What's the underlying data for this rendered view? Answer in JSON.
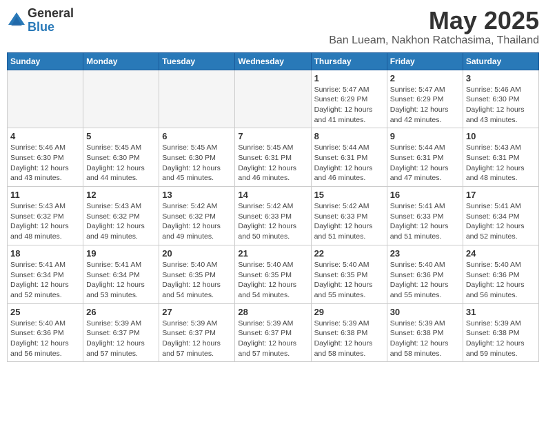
{
  "logo": {
    "general": "General",
    "blue": "Blue"
  },
  "title": "May 2025",
  "location": "Ban Lueam, Nakhon Ratchasima, Thailand",
  "days_of_week": [
    "Sunday",
    "Monday",
    "Tuesday",
    "Wednesday",
    "Thursday",
    "Friday",
    "Saturday"
  ],
  "weeks": [
    [
      {
        "day": "",
        "info": ""
      },
      {
        "day": "",
        "info": ""
      },
      {
        "day": "",
        "info": ""
      },
      {
        "day": "",
        "info": ""
      },
      {
        "day": "1",
        "info": "Sunrise: 5:47 AM\nSunset: 6:29 PM\nDaylight: 12 hours\nand 41 minutes."
      },
      {
        "day": "2",
        "info": "Sunrise: 5:47 AM\nSunset: 6:29 PM\nDaylight: 12 hours\nand 42 minutes."
      },
      {
        "day": "3",
        "info": "Sunrise: 5:46 AM\nSunset: 6:30 PM\nDaylight: 12 hours\nand 43 minutes."
      }
    ],
    [
      {
        "day": "4",
        "info": "Sunrise: 5:46 AM\nSunset: 6:30 PM\nDaylight: 12 hours\nand 43 minutes."
      },
      {
        "day": "5",
        "info": "Sunrise: 5:45 AM\nSunset: 6:30 PM\nDaylight: 12 hours\nand 44 minutes."
      },
      {
        "day": "6",
        "info": "Sunrise: 5:45 AM\nSunset: 6:30 PM\nDaylight: 12 hours\nand 45 minutes."
      },
      {
        "day": "7",
        "info": "Sunrise: 5:45 AM\nSunset: 6:31 PM\nDaylight: 12 hours\nand 46 minutes."
      },
      {
        "day": "8",
        "info": "Sunrise: 5:44 AM\nSunset: 6:31 PM\nDaylight: 12 hours\nand 46 minutes."
      },
      {
        "day": "9",
        "info": "Sunrise: 5:44 AM\nSunset: 6:31 PM\nDaylight: 12 hours\nand 47 minutes."
      },
      {
        "day": "10",
        "info": "Sunrise: 5:43 AM\nSunset: 6:31 PM\nDaylight: 12 hours\nand 48 minutes."
      }
    ],
    [
      {
        "day": "11",
        "info": "Sunrise: 5:43 AM\nSunset: 6:32 PM\nDaylight: 12 hours\nand 48 minutes."
      },
      {
        "day": "12",
        "info": "Sunrise: 5:43 AM\nSunset: 6:32 PM\nDaylight: 12 hours\nand 49 minutes."
      },
      {
        "day": "13",
        "info": "Sunrise: 5:42 AM\nSunset: 6:32 PM\nDaylight: 12 hours\nand 49 minutes."
      },
      {
        "day": "14",
        "info": "Sunrise: 5:42 AM\nSunset: 6:33 PM\nDaylight: 12 hours\nand 50 minutes."
      },
      {
        "day": "15",
        "info": "Sunrise: 5:42 AM\nSunset: 6:33 PM\nDaylight: 12 hours\nand 51 minutes."
      },
      {
        "day": "16",
        "info": "Sunrise: 5:41 AM\nSunset: 6:33 PM\nDaylight: 12 hours\nand 51 minutes."
      },
      {
        "day": "17",
        "info": "Sunrise: 5:41 AM\nSunset: 6:34 PM\nDaylight: 12 hours\nand 52 minutes."
      }
    ],
    [
      {
        "day": "18",
        "info": "Sunrise: 5:41 AM\nSunset: 6:34 PM\nDaylight: 12 hours\nand 52 minutes."
      },
      {
        "day": "19",
        "info": "Sunrise: 5:41 AM\nSunset: 6:34 PM\nDaylight: 12 hours\nand 53 minutes."
      },
      {
        "day": "20",
        "info": "Sunrise: 5:40 AM\nSunset: 6:35 PM\nDaylight: 12 hours\nand 54 minutes."
      },
      {
        "day": "21",
        "info": "Sunrise: 5:40 AM\nSunset: 6:35 PM\nDaylight: 12 hours\nand 54 minutes."
      },
      {
        "day": "22",
        "info": "Sunrise: 5:40 AM\nSunset: 6:35 PM\nDaylight: 12 hours\nand 55 minutes."
      },
      {
        "day": "23",
        "info": "Sunrise: 5:40 AM\nSunset: 6:36 PM\nDaylight: 12 hours\nand 55 minutes."
      },
      {
        "day": "24",
        "info": "Sunrise: 5:40 AM\nSunset: 6:36 PM\nDaylight: 12 hours\nand 56 minutes."
      }
    ],
    [
      {
        "day": "25",
        "info": "Sunrise: 5:40 AM\nSunset: 6:36 PM\nDaylight: 12 hours\nand 56 minutes."
      },
      {
        "day": "26",
        "info": "Sunrise: 5:39 AM\nSunset: 6:37 PM\nDaylight: 12 hours\nand 57 minutes."
      },
      {
        "day": "27",
        "info": "Sunrise: 5:39 AM\nSunset: 6:37 PM\nDaylight: 12 hours\nand 57 minutes."
      },
      {
        "day": "28",
        "info": "Sunrise: 5:39 AM\nSunset: 6:37 PM\nDaylight: 12 hours\nand 57 minutes."
      },
      {
        "day": "29",
        "info": "Sunrise: 5:39 AM\nSunset: 6:38 PM\nDaylight: 12 hours\nand 58 minutes."
      },
      {
        "day": "30",
        "info": "Sunrise: 5:39 AM\nSunset: 6:38 PM\nDaylight: 12 hours\nand 58 minutes."
      },
      {
        "day": "31",
        "info": "Sunrise: 5:39 AM\nSunset: 6:38 PM\nDaylight: 12 hours\nand 59 minutes."
      }
    ]
  ]
}
